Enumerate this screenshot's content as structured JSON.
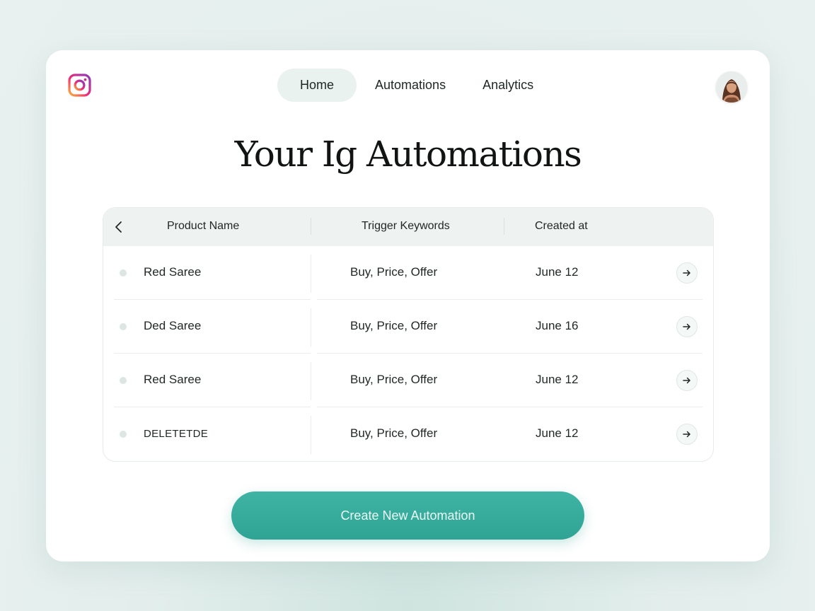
{
  "brand": {
    "icon": "instagram-icon"
  },
  "nav": {
    "items": [
      {
        "label": "Home",
        "active": true
      },
      {
        "label": "Automations",
        "active": false
      },
      {
        "label": "Analytics",
        "active": false
      }
    ]
  },
  "user": {
    "avatar": "user-avatar"
  },
  "page": {
    "title": "Your Ig Automations"
  },
  "table": {
    "back_icon": "chevron-left-icon",
    "columns": [
      "Product Name",
      "Trigger Keywords",
      "Created at"
    ],
    "rows": [
      {
        "product": "Red Saree",
        "keywords": "Buy, Price, Offer",
        "created": "June 12"
      },
      {
        "product": "Ded Saree",
        "keywords": "Buy, Price, Offer",
        "created": "June 16"
      },
      {
        "product": "Red Saree",
        "keywords": "Buy, Price, Offer",
        "created": "June 12"
      },
      {
        "product": "DELETETDE",
        "keywords": "Buy, Price, Offer",
        "created": "June 12"
      }
    ],
    "row_action_icon": "arrow-right-icon"
  },
  "cta": {
    "label": "Create New Automation"
  },
  "colors": {
    "accent": "#35a99a",
    "background": "#e6efed",
    "header": "#eef3f1"
  }
}
